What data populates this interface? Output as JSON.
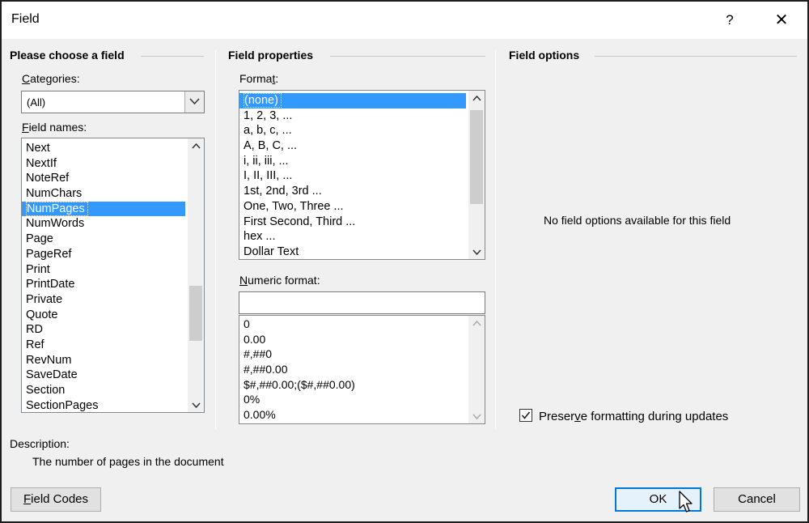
{
  "window": {
    "title": "Field",
    "help_label": "?",
    "close_label": "✕"
  },
  "left_panel": {
    "title": "Please choose a field",
    "categories_label_u": "C",
    "categories_label_rest": "ategories:",
    "category_value": "(All)",
    "field_names_label_u": "F",
    "field_names_label_rest": "ield names:",
    "field_names": [
      "Next",
      "NextIf",
      "NoteRef",
      "NumChars",
      "NumPages",
      "NumWords",
      "Page",
      "PageRef",
      "Print",
      "PrintDate",
      "Private",
      "Quote",
      "RD",
      "Ref",
      "RevNum",
      "SaveDate",
      "Section",
      "SectionPages"
    ],
    "selected_field": "NumPages"
  },
  "middle_panel": {
    "title": "Field properties",
    "format_label_pre": "Forma",
    "format_label_u": "t",
    "format_label_post": ":",
    "formats": [
      "(none)",
      "1, 2, 3, ...",
      "a, b, c, ...",
      "A, B, C, ...",
      "i, ii, iii, ...",
      "I, II, III, ...",
      "1st, 2nd, 3rd ...",
      "One, Two, Three ...",
      "First Second, Third ...",
      "hex ...",
      "Dollar Text"
    ],
    "selected_format": "(none)",
    "numeric_label_u": "N",
    "numeric_label_rest": "umeric format:",
    "numeric_value": "",
    "numeric_formats": [
      "0",
      "0.00",
      "#,##0",
      "#,##0.00",
      "$#,##0.00;($#,##0.00)",
      "0%",
      "0.00%"
    ]
  },
  "right_panel": {
    "title": "Field options",
    "empty_message": "No field options available for this field",
    "preserve_label_pre": "Preser",
    "preserve_label_u": "v",
    "preserve_label_post": "e formatting during updates",
    "preserve_checked": true
  },
  "description": {
    "label": "Description:",
    "text": "The number of pages in the document"
  },
  "buttons": {
    "field_codes_u": "F",
    "field_codes_rest": "ield Codes",
    "ok": "OK",
    "cancel": "Cancel"
  },
  "icons": {
    "combo": "chevron-down-icon",
    "scroll_up": "chevron-up-icon",
    "scroll_down": "chevron-down-icon",
    "check": "check-icon",
    "cursor": "mouse-pointer-icon"
  },
  "colors": {
    "selection": "#3399ff",
    "dialog_bg": "#f0f0f0",
    "default_button_border": "#0078d7"
  }
}
